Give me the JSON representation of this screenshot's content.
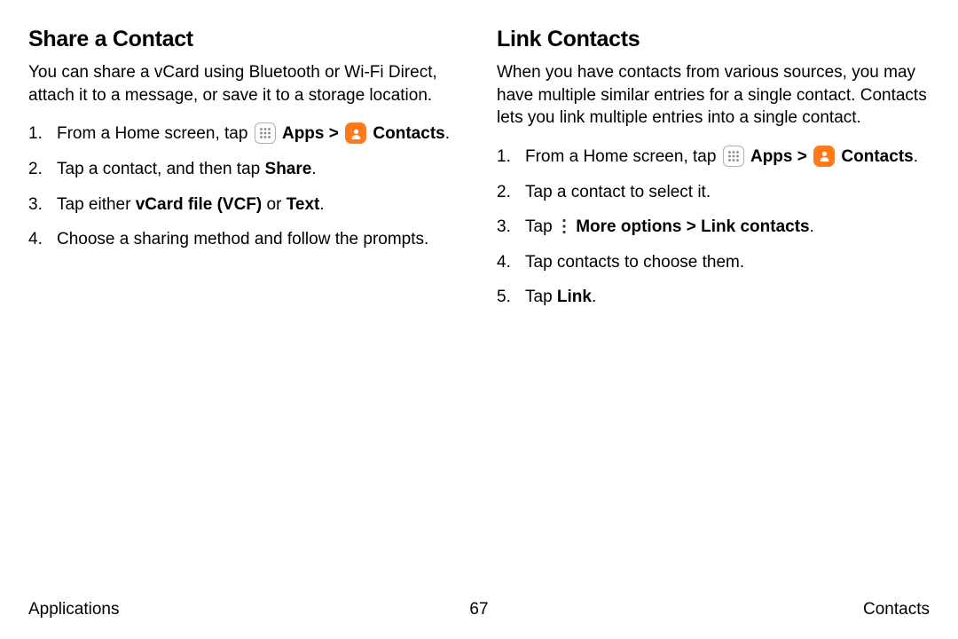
{
  "left": {
    "heading": "Share a Contact",
    "intro": "You can share a vCard using Bluetooth or Wi-Fi Direct, attach it to a message, or save it to a storage location.",
    "steps": {
      "s1_pre": "From a Home screen, tap ",
      "s1_apps": "Apps",
      "s1_caret": " > ",
      "s1_contacts": "Contacts",
      "s1_end": ".",
      "s2_pre": "Tap a contact, and then tap ",
      "s2_share": "Share",
      "s2_end": ".",
      "s3_pre": "Tap either ",
      "s3_vcf": "vCard file (VCF)",
      "s3_or": " or ",
      "s3_text": "Text",
      "s3_end": ".",
      "s4": "Choose a sharing method and follow the prompts."
    }
  },
  "right": {
    "heading": "Link Contacts",
    "intro": "When you have contacts from various sources, you may have multiple similar entries for a single contact. Contacts lets you link multiple entries into a single contact.",
    "steps": {
      "s1_pre": "From a Home screen, tap ",
      "s1_apps": "Apps",
      "s1_caret": " > ",
      "s1_contacts": "Contacts",
      "s1_end": ".",
      "s2": "Tap a contact to select it.",
      "s3_pre": "Tap ",
      "s3_more": "More options",
      "s3_caret": " > ",
      "s3_link": "Link contacts",
      "s3_end": ".",
      "s4": "Tap contacts to choose them.",
      "s5_pre": "Tap ",
      "s5_link": "Link",
      "s5_end": "."
    }
  },
  "footer": {
    "left": "Applications",
    "page": "67",
    "right": "Contacts"
  }
}
